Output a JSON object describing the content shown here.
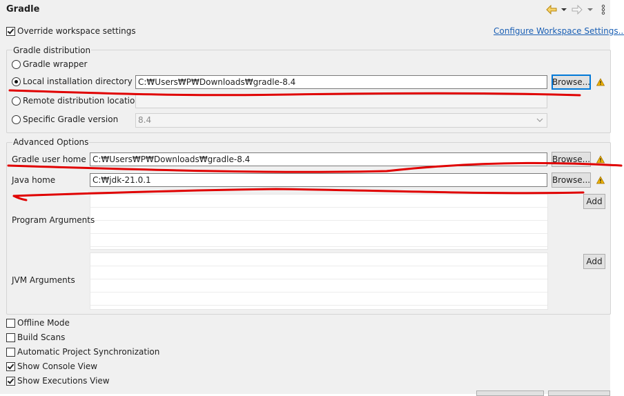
{
  "header": {
    "title": "Gradle"
  },
  "toolbar": {
    "back_icon": "back-arrow-icon",
    "forward_icon": "forward-arrow-icon",
    "menu_icon": "view-menu-icon"
  },
  "override": {
    "label": "Override workspace settings",
    "checked": true
  },
  "configure_link": "Configure Workspace Settings...",
  "distribution": {
    "title": "Gradle distribution",
    "options": [
      {
        "label": "Gradle wrapper",
        "selected": false
      },
      {
        "label": "Local installation directory",
        "selected": true
      },
      {
        "label": "Remote distribution location",
        "selected": false
      },
      {
        "label": "Specific Gradle version",
        "selected": false
      }
    ],
    "local_dir_value": "C:₩Users₩P₩Downloads₩gradle-8.4",
    "version_value": "8.4",
    "browse_label": "Browse..."
  },
  "advanced": {
    "title": "Advanced Options",
    "user_home_label": "Gradle user home",
    "user_home_value": "C:₩Users₩P₩Downloads₩gradle-8.4",
    "java_home_label": "Java home",
    "java_home_value": "C:₩jdk-21.0.1",
    "browse_label": "Browse...",
    "program_args_label": "Program Arguments",
    "jvm_args_label": "JVM Arguments",
    "add_label": "Add"
  },
  "options": [
    {
      "label": "Offline Mode",
      "checked": false
    },
    {
      "label": "Build Scans",
      "checked": false
    },
    {
      "label": "Automatic Project Synchronization",
      "checked": false
    },
    {
      "label": "Show Console View",
      "checked": true
    },
    {
      "label": "Show Executions View",
      "checked": true
    }
  ],
  "colors": {
    "accent": "#0078d7",
    "link": "#1a5fb4",
    "warning": "#f0b400",
    "annotation": "#e00000"
  }
}
